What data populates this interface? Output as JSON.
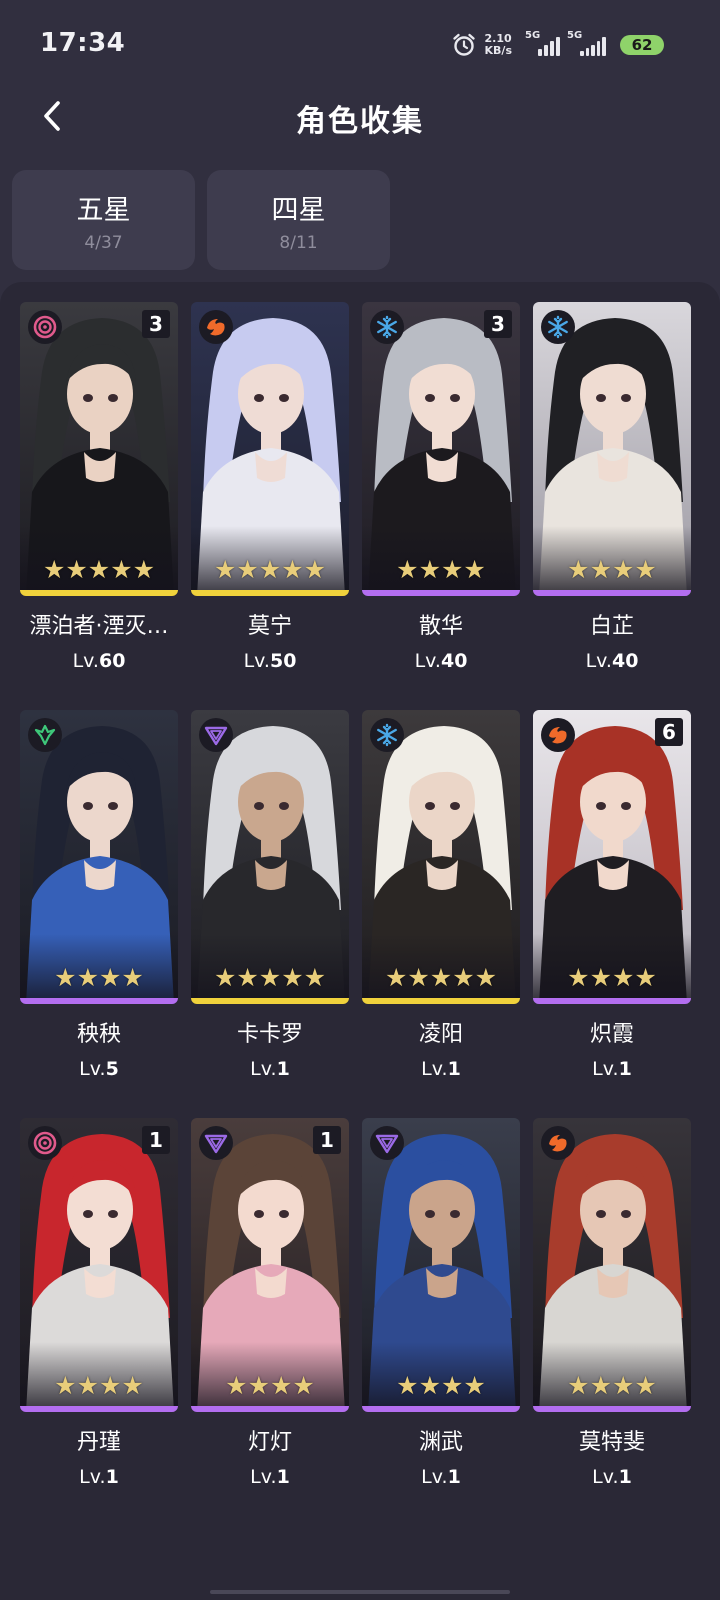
{
  "status_bar": {
    "time": "17:34",
    "net_speed_value": "2.10",
    "net_speed_unit": "KB/s",
    "signal_1_label": "5G",
    "signal_2_label": "5G",
    "battery": "62",
    "icons": [
      "alarm-icon",
      "signal-icon",
      "signal-icon",
      "battery-icon"
    ]
  },
  "header": {
    "title": "角色收集",
    "back_icon": "chevron-left-icon"
  },
  "tabs": [
    {
      "label": "五星",
      "count": "4/37"
    },
    {
      "label": "四星",
      "count": "8/11"
    }
  ],
  "colors": {
    "background": "#312f3f",
    "panel": "#2a2836",
    "five_star_bar": "#f0d23c",
    "four_star_bar": "#b36ef0",
    "star": "#e8cd7a",
    "element_spectro": "#e05a8c",
    "element_fusion": "#f06a2a",
    "element_glacio": "#4aa8e8",
    "element_aero": "#3ec87a",
    "element_electro": "#9b6ae6"
  },
  "level_prefix": "Lv.",
  "characters": [
    {
      "name": "漂泊者·湮灭…",
      "level": "60",
      "stars": "★★★★★",
      "rarity": 5,
      "element": "spectro",
      "element_icon": "spectro-swirl-icon",
      "dupes": "3"
    },
    {
      "name": "莫宁",
      "level": "50",
      "stars": "★★★★★",
      "rarity": 5,
      "element": "fusion",
      "element_icon": "fusion-flame-icon",
      "dupes": ""
    },
    {
      "name": "散华",
      "level": "40",
      "stars": "★★★★",
      "rarity": 4,
      "element": "glacio",
      "element_icon": "glacio-snowflake-icon",
      "dupes": "3"
    },
    {
      "name": "白芷",
      "level": "40",
      "stars": "★★★★",
      "rarity": 4,
      "element": "glacio",
      "element_icon": "glacio-snowflake-icon",
      "dupes": ""
    },
    {
      "name": "秧秧",
      "level": "5",
      "stars": "★★★★",
      "rarity": 4,
      "element": "aero",
      "element_icon": "aero-wind-icon",
      "dupes": ""
    },
    {
      "name": "卡卡罗",
      "level": "1",
      "stars": "★★★★★",
      "rarity": 5,
      "element": "electro",
      "element_icon": "electro-bolt-icon",
      "dupes": ""
    },
    {
      "name": "凌阳",
      "level": "1",
      "stars": "★★★★★",
      "rarity": 5,
      "element": "glacio",
      "element_icon": "glacio-snowflake-icon",
      "dupes": ""
    },
    {
      "name": "炽霞",
      "level": "1",
      "stars": "★★★★",
      "rarity": 4,
      "element": "fusion",
      "element_icon": "fusion-flame-icon",
      "dupes": "6"
    },
    {
      "name": "丹瑾",
      "level": "1",
      "stars": "★★★★",
      "rarity": 4,
      "element": "spectro",
      "element_icon": "spectro-swirl-icon",
      "dupes": "1"
    },
    {
      "name": "灯灯",
      "level": "1",
      "stars": "★★★★",
      "rarity": 4,
      "element": "electro",
      "element_icon": "electro-bolt-icon",
      "dupes": "1"
    },
    {
      "name": "渊武",
      "level": "1",
      "stars": "★★★★",
      "rarity": 4,
      "element": "electro",
      "element_icon": "electro-bolt-icon",
      "dupes": ""
    },
    {
      "name": "莫特斐",
      "level": "1",
      "stars": "★★★★",
      "rarity": 4,
      "element": "fusion",
      "element_icon": "fusion-flame-icon",
      "dupes": ""
    }
  ]
}
